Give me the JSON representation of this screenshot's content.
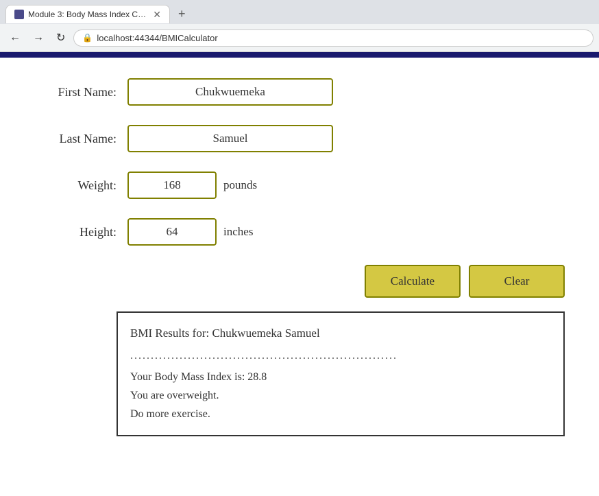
{
  "browser": {
    "tab_title": "Module 3: Body Mass Index Calc...",
    "new_tab_icon": "+",
    "back_icon": "←",
    "forward_icon": "→",
    "refresh_icon": "↻",
    "lock_icon": "🔒",
    "url": "localhost:44344/BMICalculator"
  },
  "form": {
    "first_name_label": "First Name:",
    "last_name_label": "Last Name:",
    "weight_label": "Weight:",
    "height_label": "Height:",
    "first_name_value": "Chukwuemeka",
    "last_name_value": "Samuel",
    "weight_value": "168",
    "height_value": "64",
    "weight_unit": "pounds",
    "height_unit": "inches"
  },
  "buttons": {
    "calculate_label": "Calculate",
    "clear_label": "Clear"
  },
  "result": {
    "title": "BMI Results for: Chukwuemeka Samuel",
    "dots": ".................................................................",
    "bmi_line": "Your Body Mass Index is: 28.8",
    "status_line": "You are overweight.",
    "advice_line": "Do more exercise."
  }
}
